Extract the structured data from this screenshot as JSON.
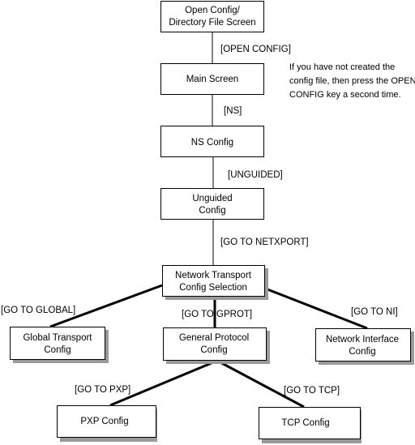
{
  "nodes": {
    "open_config": [
      "Open Config/",
      "Directory File Screen"
    ],
    "main_screen": [
      "Main Screen"
    ],
    "ns_config": [
      "NS Config"
    ],
    "unguided_config": [
      "Unguided",
      "Config"
    ],
    "network_transport": [
      "Network Transport",
      "Config Selection"
    ],
    "global_transport": [
      "Global Transport",
      "Config"
    ],
    "general_protocol": [
      "General Protocol",
      "Config"
    ],
    "network_interface": [
      "Network Interface",
      "Config"
    ],
    "pxp_config": [
      "PXP Config"
    ],
    "tcp_config": [
      "TCP Config"
    ]
  },
  "edges": {
    "open_config": "[OPEN CONFIG]",
    "ns": "[NS]",
    "unguided": "[UNGUIDED]",
    "netxport": "[GO TO NETXPORT]",
    "global": "[GO TO GLOBAL]",
    "gprot": "[GO TO GPROT]",
    "ni": "[GO TO NI]",
    "pxp": "[GO TO PXP]",
    "tcp": "[GO TO TCP]"
  },
  "note": "If you have not created the config file, then press the OPEN CONFIG key a second time."
}
